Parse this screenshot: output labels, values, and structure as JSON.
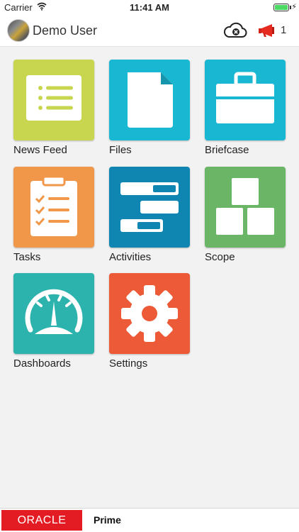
{
  "status_bar": {
    "carrier": "Carrier",
    "time": "11:41 AM"
  },
  "header": {
    "user_name": "Demo User",
    "notification_count": "1"
  },
  "tiles": [
    {
      "label": "News Feed",
      "icon": "news-feed-icon",
      "color": "#c8d64f"
    },
    {
      "label": "Files",
      "icon": "file-icon",
      "color": "#1ab7d2"
    },
    {
      "label": "Briefcase",
      "icon": "briefcase-icon",
      "color": "#1ab7d2"
    },
    {
      "label": "Tasks",
      "icon": "clipboard-checklist-icon",
      "color": "#f0974a"
    },
    {
      "label": "Activities",
      "icon": "gantt-bars-icon",
      "color": "#0e86b1"
    },
    {
      "label": "Scope",
      "icon": "stacked-blocks-icon",
      "color": "#6ab566"
    },
    {
      "label": "Dashboards",
      "icon": "gauge-icon",
      "color": "#2db3ad"
    },
    {
      "label": "Settings",
      "icon": "gear-icon",
      "color": "#ec5a38"
    }
  ],
  "footer": {
    "logo_text": "ORACLE",
    "product": "Prime"
  }
}
